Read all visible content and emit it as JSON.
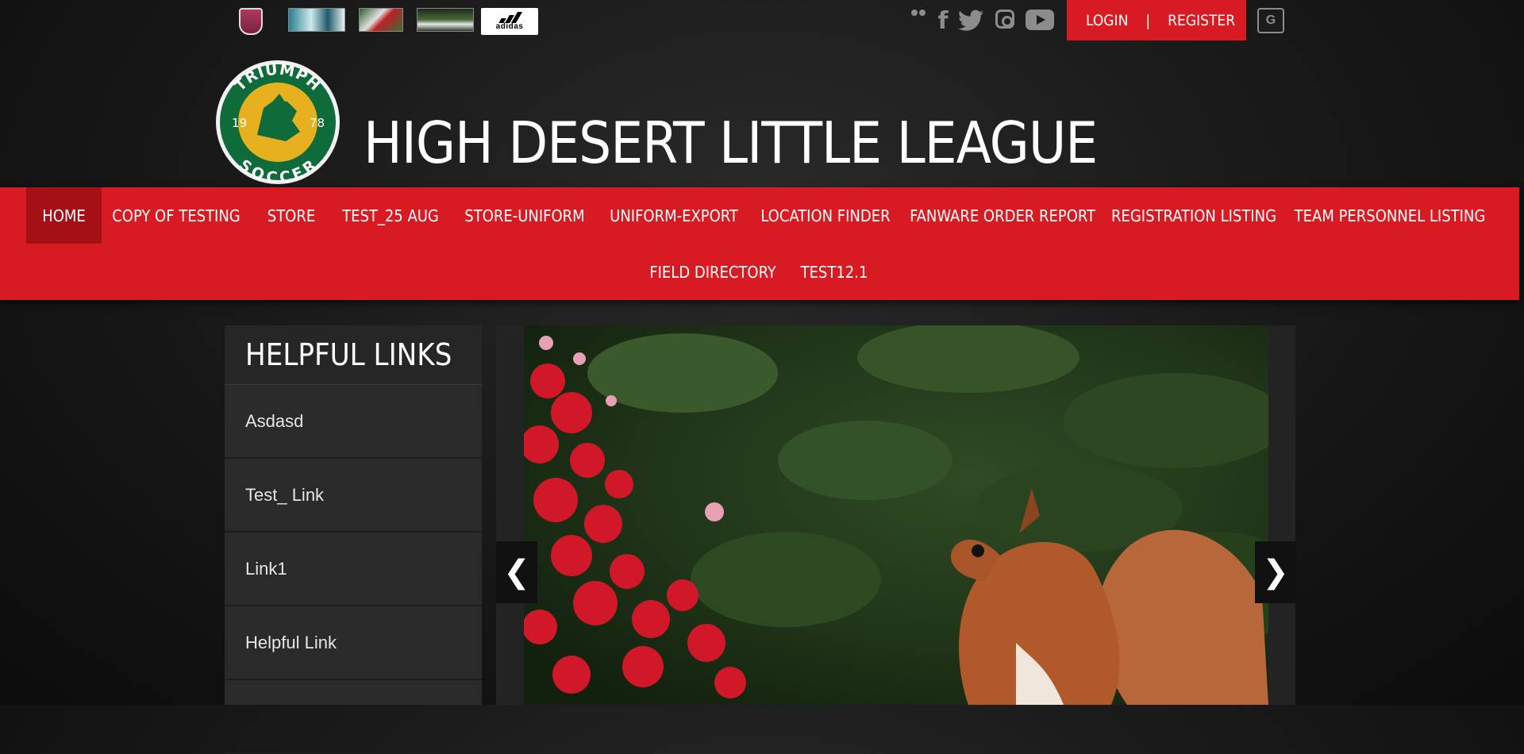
{
  "header": {
    "site_title": "HIGH DESERT LITTLE LEAGUE",
    "logo": {
      "top_text": "TRIUMPH",
      "bottom_text": "SOCCER",
      "year_left": "19",
      "year_right": "78",
      "colors": {
        "ring": "#0f6b3a",
        "inner": "#e6b01e"
      }
    },
    "sponsor_brand": "adidas",
    "auth": {
      "login_label": "LOGIN",
      "separator": "|",
      "register_label": "REGISTER"
    },
    "translate_icon_text": "G"
  },
  "nav": {
    "items": [
      {
        "label": "HOME",
        "active": true
      },
      {
        "label": "COPY OF TESTING"
      },
      {
        "label": "STORE"
      },
      {
        "label": "TEST_25 AUG"
      },
      {
        "label": "STORE-UNIFORM"
      },
      {
        "label": "UNIFORM-EXPORT"
      },
      {
        "label": "LOCATION FINDER"
      },
      {
        "label": "FANWARE ORDER REPORT"
      },
      {
        "label": "REGISTRATION LISTING"
      },
      {
        "label": "TEAM PERSONNEL LISTING"
      },
      {
        "label": "FIELD DIRECTORY"
      },
      {
        "label": "TEST12.1"
      }
    ]
  },
  "sidebar": {
    "title": "HELPFUL LINKS",
    "links": [
      {
        "label": "Asdasd"
      },
      {
        "label": "Test_ Link"
      },
      {
        "label": "Link1"
      },
      {
        "label": "Helpful Link"
      }
    ]
  },
  "slider": {
    "prev_label": "❮",
    "next_label": "❯"
  },
  "colors": {
    "brand_red": "#d81a22",
    "active_red": "#a50f16",
    "panel": "#2a2a2a",
    "icon_gray": "#8c8c8c"
  }
}
